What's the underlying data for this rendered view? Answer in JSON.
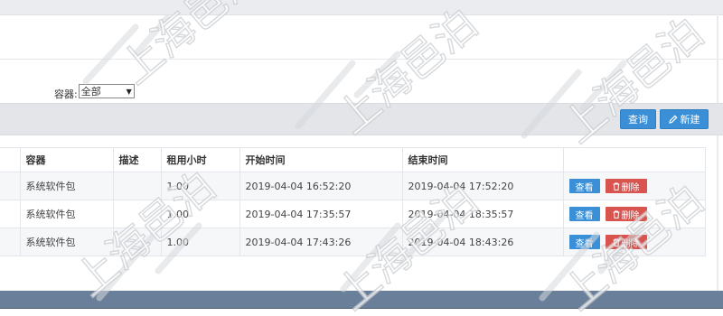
{
  "filter": {
    "label": "容器:",
    "selected": "全部"
  },
  "toolbar": {
    "query_label": "查询",
    "new_label": "新建"
  },
  "table": {
    "columns": [
      "",
      "容器",
      "描述",
      "租用小时",
      "开始时间",
      "结束时间",
      ""
    ],
    "rows": [
      {
        "container": "系统软件包",
        "desc": "",
        "hours": "1.00",
        "start": "2019-04-04 16:52:20",
        "end": "2019-04-04 17:52:20",
        "view": "查看",
        "delete": "删除"
      },
      {
        "container": "系统软件包",
        "desc": "",
        "hours": "1.00",
        "start": "2019-04-04 17:35:57",
        "end": "2019-04-04 18:35:57",
        "view": "查看",
        "delete": "删除"
      },
      {
        "container": "系统软件包",
        "desc": "",
        "hours": "1.00",
        "start": "2019-04-04 17:43:26",
        "end": "2019-04-04 18:43:26",
        "view": "查看",
        "delete": "删除"
      }
    ]
  },
  "watermark": {
    "text": "上海邑泊"
  },
  "colors": {
    "primary": "#3a8fd6",
    "danger": "#d9534f",
    "footer": "#6a7f99"
  }
}
